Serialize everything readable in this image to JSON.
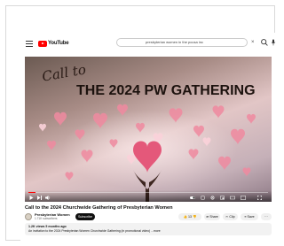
{
  "header": {
    "logo_text": "YouTube",
    "search_query": "presbyterian women in the pcusa inc",
    "clear_glyph": "×"
  },
  "video": {
    "overlay_script": "Call to",
    "overlay_title": "THE 2024 PW GATHERING"
  },
  "watch": {
    "title": "Call to the 2024 Churchwide Gathering of Presbyterian Women",
    "channel": "Presbyterian Women",
    "subscribers": "1.71K subscribers",
    "subscribe_label": "Subscribe",
    "likes": "13",
    "share_label": "Share",
    "clip_label": "Clip",
    "save_label": "Save",
    "more_label": "···",
    "views": "1.2K views  5 months ago",
    "description_snippet": "An invitation to the 2024 Presbyterian Women Churchwide Gathering (in promotional video) ...more"
  },
  "colors": {
    "brand_red": "#ff0000",
    "subscribe_bg": "#0f0f0f",
    "heart_pink": "#f08aa0"
  }
}
